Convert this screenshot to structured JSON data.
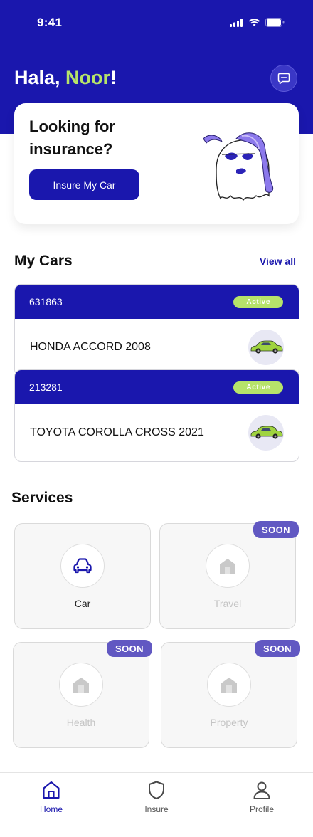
{
  "status_bar": {
    "time": "9:41"
  },
  "header": {
    "greeting_prefix": "Hala, ",
    "user_name": "Noor",
    "greeting_suffix": "!"
  },
  "promo": {
    "title": "Looking for insurance?",
    "button_label": "Insure My Car"
  },
  "my_cars": {
    "title": "My Cars",
    "view_all_label": "View all",
    "cars": [
      {
        "plate": "631863",
        "status": "Active",
        "name": "HONDA ACCORD 2008"
      },
      {
        "plate": "213281",
        "status": "Active",
        "name": "TOYOTA COROLLA CROSS 2021"
      }
    ]
  },
  "services": {
    "title": "Services",
    "items": [
      {
        "label": "Car",
        "badge": "",
        "icon": "car-icon"
      },
      {
        "label": "Travel",
        "badge": "SOON",
        "icon": "house-icon"
      },
      {
        "label": "Health",
        "badge": "SOON",
        "icon": "house-icon"
      },
      {
        "label": "Property",
        "badge": "SOON",
        "icon": "house-icon"
      }
    ]
  },
  "bottom_nav": {
    "items": [
      {
        "label": "Home",
        "icon": "home-icon"
      },
      {
        "label": "Insure",
        "icon": "shield-icon"
      },
      {
        "label": "Profile",
        "icon": "user-icon"
      }
    ]
  },
  "colors": {
    "brand": "#1a17ad",
    "accent": "#b6e36a",
    "soon_badge": "#6158c2"
  }
}
